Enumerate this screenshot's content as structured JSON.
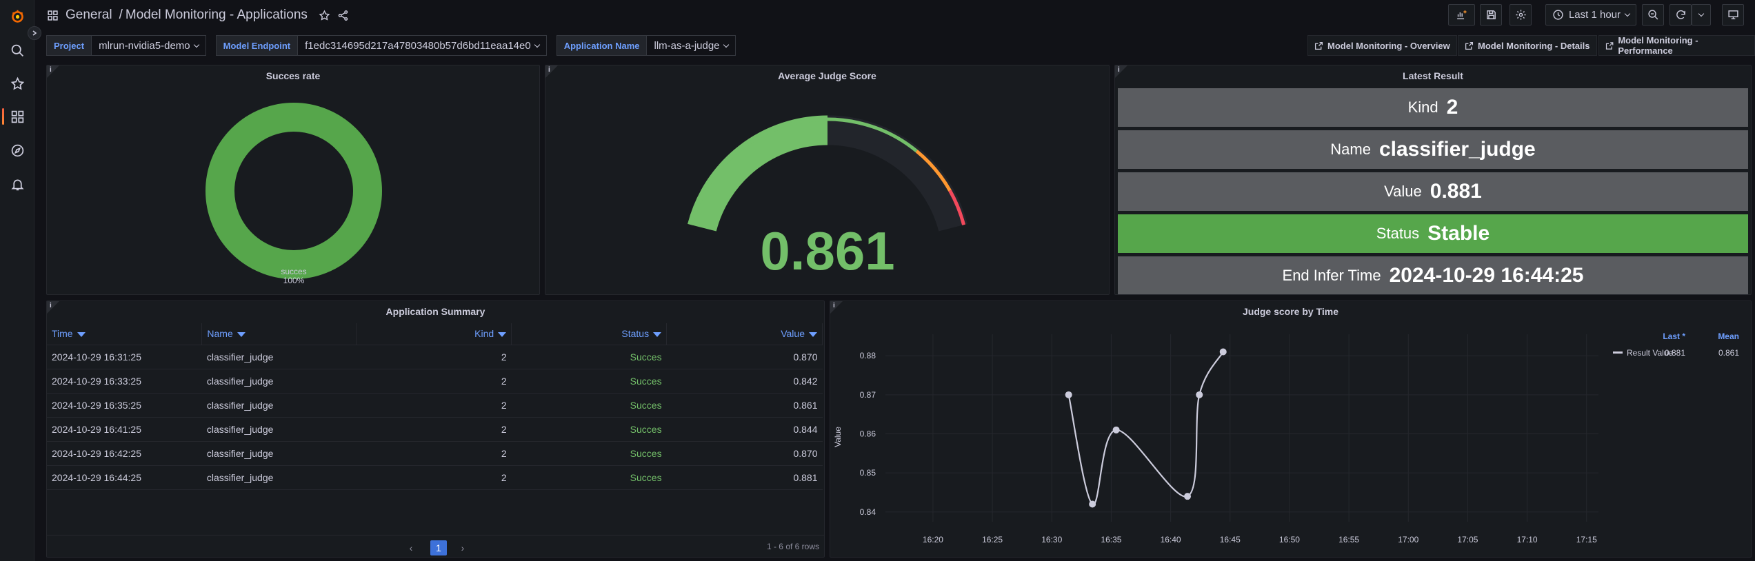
{
  "breadcrumb": {
    "folder": "General",
    "separator": "/",
    "title": "Model Monitoring - Applications"
  },
  "toolbar": {
    "time_range": "Last 1 hour"
  },
  "variables": [
    {
      "label": "Project",
      "value": "mlrun-nvidia5-demo"
    },
    {
      "label": "Model Endpoint",
      "value": "f1edc314695d217a47803480b57d6bd11eaa14e0"
    },
    {
      "label": "Application Name",
      "value": "llm-as-a-judge"
    }
  ],
  "links": [
    "Model Monitoring - Overview",
    "Model Monitoring - Details",
    "Model Monitoring - Performance"
  ],
  "info_glyph": "i",
  "success_panel": {
    "title": "Succes rate",
    "label": "succes",
    "percent": "100%",
    "fraction": 1.0,
    "color": "#56a64b"
  },
  "gauge_panel": {
    "title": "Average Judge Score",
    "value": "0.861",
    "fraction": 0.861,
    "colors": {
      "green": "#73bf69",
      "orange": "#ff9830",
      "red": "#f2495c"
    }
  },
  "latest_panel": {
    "title": "Latest Result",
    "rows": [
      {
        "key": "Kind",
        "value": "2",
        "status": "normal"
      },
      {
        "key": "Name",
        "value": "classifier_judge",
        "status": "normal"
      },
      {
        "key": "Value",
        "value": "0.881",
        "status": "normal"
      },
      {
        "key": "Status",
        "value": "Stable",
        "status": "good"
      },
      {
        "key": "End Infer Time",
        "value": "2024-10-29 16:44:25",
        "status": "normal"
      }
    ]
  },
  "table_panel": {
    "title": "Application Summary",
    "headers": [
      "Time",
      "Name",
      "Kind",
      "Status",
      "Value"
    ],
    "rows": [
      [
        "2024-10-29 16:31:25",
        "classifier_judge",
        "2",
        "Succes",
        "0.870"
      ],
      [
        "2024-10-29 16:33:25",
        "classifier_judge",
        "2",
        "Succes",
        "0.842"
      ],
      [
        "2024-10-29 16:35:25",
        "classifier_judge",
        "2",
        "Succes",
        "0.861"
      ],
      [
        "2024-10-29 16:41:25",
        "classifier_judge",
        "2",
        "Succes",
        "0.844"
      ],
      [
        "2024-10-29 16:42:25",
        "classifier_judge",
        "2",
        "Succes",
        "0.870"
      ],
      [
        "2024-10-29 16:44:25",
        "classifier_judge",
        "2",
        "Succes",
        "0.881"
      ]
    ],
    "page": "1",
    "count_text": "1 - 6 of 6 rows",
    "prev": "‹",
    "next": "›"
  },
  "chart_panel": {
    "title": "Judge score by Time",
    "legend_headers": [
      "Last *",
      "Mean"
    ],
    "legend_row": {
      "name": "Result Value",
      "last": "0.881",
      "mean": "0.861"
    }
  },
  "chart_data": {
    "type": "line",
    "title": "Judge score by Time",
    "xlabel": "",
    "ylabel": "Value",
    "x_ticks": [
      "16:20",
      "16:25",
      "16:30",
      "16:35",
      "16:40",
      "16:45",
      "16:50",
      "16:55",
      "17:00",
      "17:05",
      "17:10",
      "17:15"
    ],
    "y_ticks": [
      "0.84",
      "0.85",
      "0.86",
      "0.87",
      "0.88"
    ],
    "xlim": [
      "16:16",
      "17:16"
    ],
    "ylim": [
      0.8375,
      0.8855
    ],
    "series": [
      {
        "name": "Result Value",
        "color": "#ccccdc",
        "x": [
          "16:31:25",
          "16:33:25",
          "16:35:25",
          "16:41:25",
          "16:42:25",
          "16:44:25"
        ],
        "values": [
          0.87,
          0.842,
          0.861,
          0.844,
          0.87,
          0.881
        ]
      }
    ],
    "grid": true,
    "legend": "right"
  }
}
